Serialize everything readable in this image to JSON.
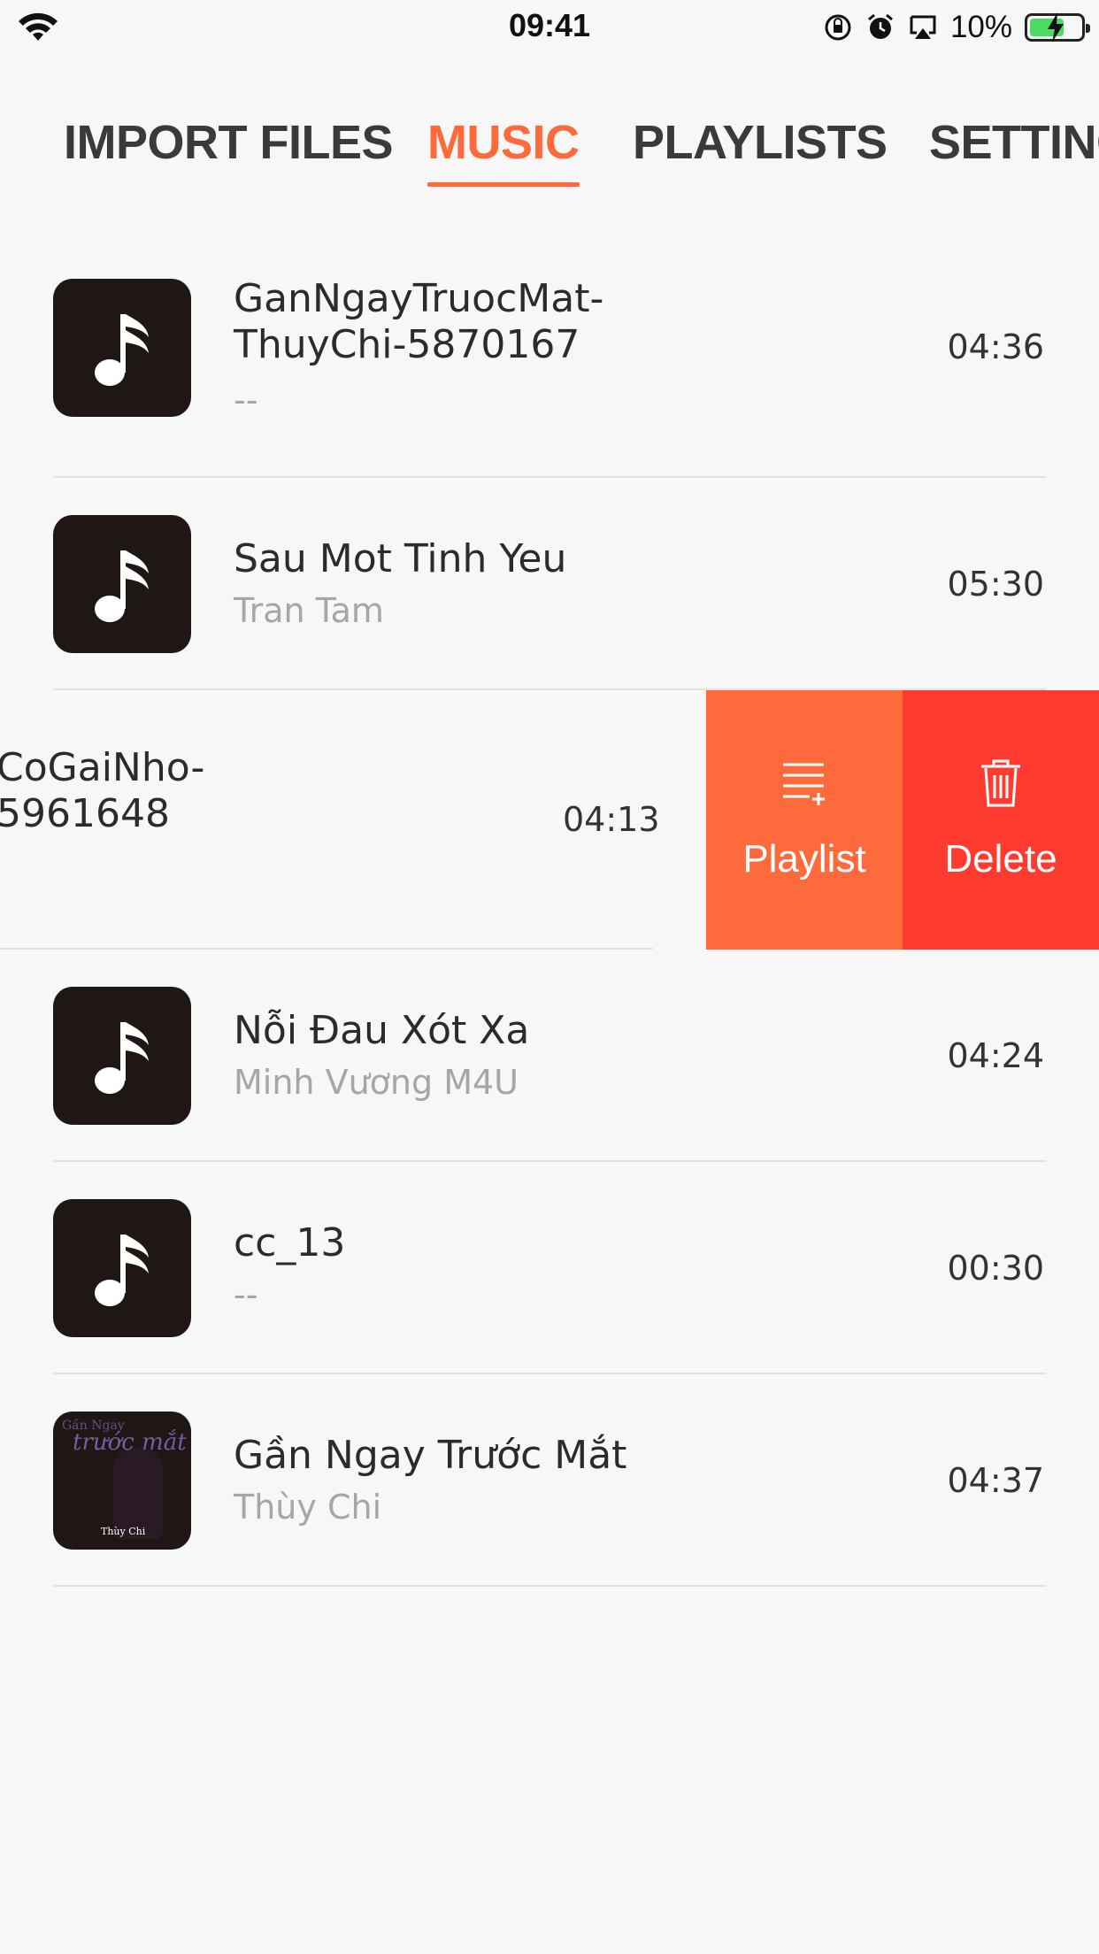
{
  "status_bar": {
    "time": "09:41",
    "battery_percent": "10%",
    "battery_level": 0.1,
    "icons": [
      "wifi-icon",
      "orientation-lock-icon",
      "alarm-icon",
      "airplay-icon",
      "battery-icon"
    ]
  },
  "tabs": [
    {
      "label": "IMPORT FILES",
      "active": false
    },
    {
      "label": "MUSIC",
      "active": true
    },
    {
      "label": "PLAYLISTS",
      "active": false
    },
    {
      "label": "SETTINGS",
      "active": false
    }
  ],
  "accent_color": "#ff6a3d",
  "delete_color": "#ff3b30",
  "songs": [
    {
      "title": "GanNgayTruocMat-\nThuyChi-5870167",
      "artist": "--",
      "duration": "04:36",
      "art": "music-note-icon"
    },
    {
      "title": "Sau Mot Tinh Yeu",
      "artist": "Tran Tam",
      "duration": "05:30",
      "art": "music-note-icon"
    },
    {
      "title": "CoGaiNho-\n5961648",
      "artist": "",
      "duration": "04:13",
      "art": "music-note-icon"
    },
    {
      "title": "Nỗi Đau Xót Xa",
      "artist": "Minh Vương M4U",
      "duration": "04:24",
      "art": "music-note-icon"
    },
    {
      "title": "cc_13",
      "artist": "--",
      "duration": "00:30",
      "art": "music-note-icon"
    },
    {
      "title": "Gần Ngay Trước Mắt",
      "artist": "Thùy Chi",
      "duration": "04:37",
      "art": "album-art"
    }
  ],
  "album_art": {
    "title_line": "Gần Ngay",
    "script_line": "trước mắt",
    "artist_line": "Thùy Chi"
  },
  "swipe_actions": {
    "playlist_label": "Playlist",
    "delete_label": "Delete"
  }
}
